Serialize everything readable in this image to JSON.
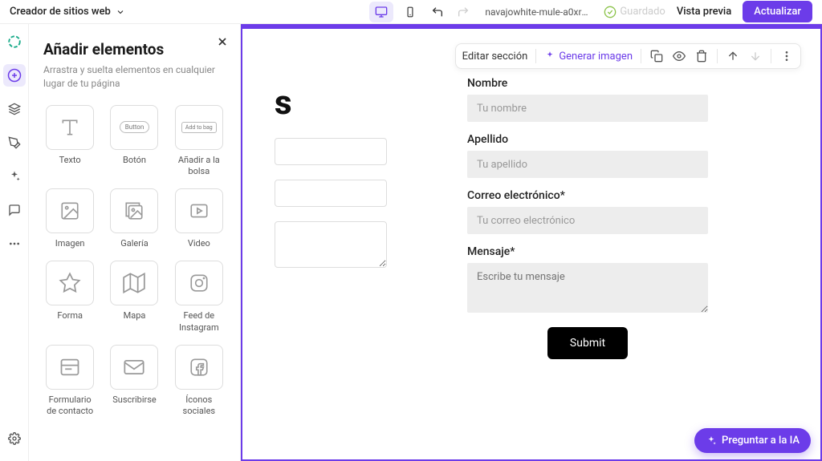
{
  "topbar": {
    "title": "Creador de sitios web",
    "url": "navajowhite-mule-a0xrbjxe2...",
    "saved": "Guardado",
    "preview": "Vista previa",
    "update": "Actualizar"
  },
  "panel": {
    "title": "Añadir elementos",
    "subtitle": "Arrastra y suelta elementos en cualquier lugar de tu página",
    "elements": {
      "text": "Texto",
      "button": "Botón",
      "button_chip": "Button",
      "addtobag": "Añadir a la bolsa",
      "addtobag_chip": "Add to bag",
      "image": "Imagen",
      "gallery": "Galería",
      "video": "Video",
      "shape": "Forma",
      "map": "Mapa",
      "instagram": "Feed de Instagram",
      "contact_form": "Formulario de contacto",
      "subscribe": "Suscribirse",
      "social": "Íconos sociales"
    }
  },
  "toolbar": {
    "edit_section": "Editar sección",
    "generate_image": "Generar imagen"
  },
  "page": {
    "fragment": "s"
  },
  "form": {
    "name_label": "Nombre",
    "name_placeholder": "Tu nombre",
    "lastname_label": "Apellido",
    "lastname_placeholder": "Tu apellido",
    "email_label": "Correo electrónico*",
    "email_placeholder": "Tu correo electrónico",
    "message_label": "Mensaje*",
    "message_placeholder": "Escribe tu mensaje",
    "submit": "Submit"
  },
  "ai": {
    "ask": "Preguntar a la IA"
  }
}
